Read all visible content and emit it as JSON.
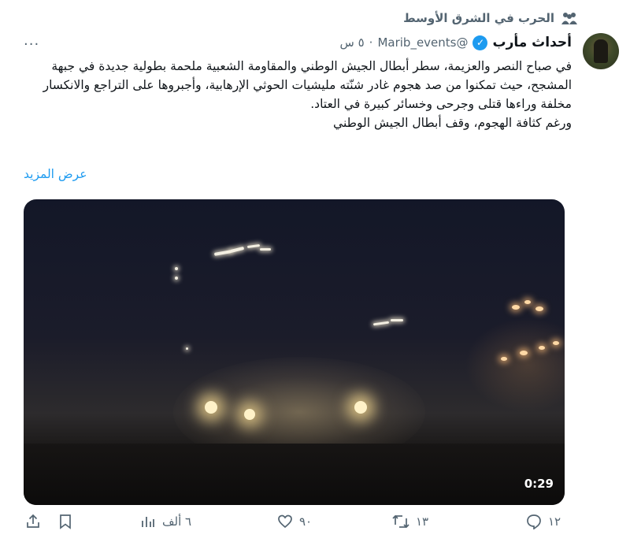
{
  "context": {
    "label": "الحرب في الشرق الأوسط",
    "icon": "community-icon"
  },
  "author": {
    "name": "أحداث مأرب",
    "handle": "@Marib_events",
    "separator": "·",
    "time": "٥ س",
    "verified": true
  },
  "more_label": "···",
  "body_lines": [
    "في صباح النصر والعزيمة، سطر أبطال الجيش الوطني والمقاومة الشعبية ملحمة بطولية جديدة في جبهة المشجح، حيث تمكنوا من صد هجوم غادر شنّته مليشيات الحوثي الإرهابية، وأجبروها على التراجع والانكسار مخلفة وراءها قتلى وجرحى وخسائر كبيرة في العتاد.",
    "ورغم كثافة الهجوم، وقف أبطال الجيش الوطني"
  ],
  "show_more": "عرض المزيد",
  "media": {
    "duration": "0:29"
  },
  "actions": {
    "reply": "١٢",
    "retweet": "١٣",
    "like": "٩٠",
    "views": "٦ ألف"
  },
  "colors": {
    "accent": "#1d9bf0",
    "muted": "#536471",
    "text": "#0f1419"
  }
}
